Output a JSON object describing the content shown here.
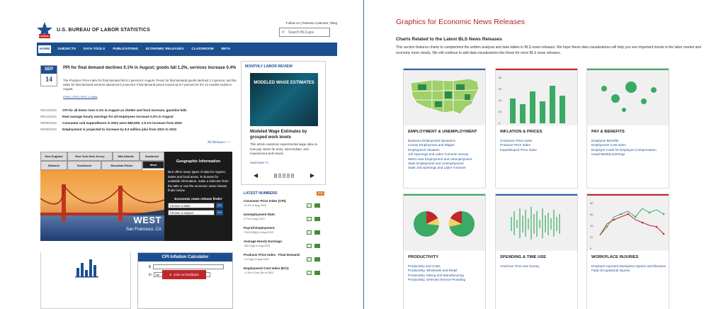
{
  "left": {
    "agency": "U.S. BUREAU OF LABOR STATISTICS",
    "utility": "Follow Us | Release Calendar | Blog",
    "search_placeholder": "Search BLS.gov",
    "nav": [
      "HOME",
      "SUBJECTS",
      "DATA TOOLS",
      "PUBLICATIONS",
      "ECONOMIC RELEASES",
      "CLASSROOM",
      "BETA"
    ],
    "featured": {
      "month": "SEP",
      "day": "14",
      "title": "PPI for final demand declines 0.1% in August; goods fall 1.2%, services increase 0.4%",
      "summary": "The Producer Price Index for final demand fell 0.1 percent in August. Prices for final demand goods declined 1.2 percent, and the index for final demand services advanced 0.4 percent. Final demand prices moved up 8.7 percent for the 12 months ended in August.",
      "links": "HTML | PDF | RSS | Charts"
    },
    "news": [
      {
        "date": "09/13/2022",
        "text": "CPI for all items rises 0.1% in August as shelter and food increase, gasoline falls"
      },
      {
        "date": "09/13/2022",
        "text": "Real average hourly earnings for all employees increase 0.2% in August"
      },
      {
        "date": "09/08/2022",
        "text": "Consumer unit expenditures in 2021 were $66,928; a 9.1% increase from 2020"
      },
      {
        "date": "09/08/2022",
        "text": "Employment is projected to increase by 8.3 million jobs from 2021 to 2031"
      }
    ],
    "all_releases": "All Releases >>",
    "region_tabs_row1": [
      "New England",
      "New York-New Jersey",
      "Mid-Atlantic",
      "Southeast"
    ],
    "region_tabs_row2": [
      "Midwest",
      "Southwest",
      "Mountain-Plains",
      "West"
    ],
    "region_photo_title": "WEST",
    "region_photo_sub": "San Francisco, CA",
    "geo": {
      "title": "Geographic Information",
      "text": "BLS offers many types of data for regions, states and local areas. To browse for available information, make a selection from the tabs or use the economic news release finder below.",
      "finder": "Economic news release finder",
      "state": "Choose a State",
      "subject": "Choose a Subject",
      "go": "GO"
    },
    "mlr": {
      "header": "MONTHLY LABOR REVIEW",
      "image_text": "MODELED WAGE ESTIMATES",
      "title": "Modeled Wage Estimates by grouped work levels",
      "desc": "This article examines experimental wage data on how pay varies for entry, intermediate, and experienced work levels.",
      "read_more": "read more >>",
      "pages": [
        "1",
        "2",
        "3",
        "4",
        "5"
      ]
    },
    "latest": {
      "header": "LATEST NUMBERS",
      "rss": "RSS",
      "items": [
        {
          "label": "Consumer Price Index (CPI):",
          "value": "+0.1% in Aug 2022"
        },
        {
          "label": "Unemployment Rate:",
          "value": "3.7% in Aug 2022"
        },
        {
          "label": "Payroll Employment:",
          "value": "+315,000(p) in Aug 2022"
        },
        {
          "label": "Average Hourly Earnings:",
          "value": "+$0.10(p) in Aug 2022"
        },
        {
          "label": "Producer Price Index - Final Demand:",
          "value": "-0.1%(p) in Aug 2022"
        },
        {
          "label": "Employment Cost Index (ECI):",
          "value": "+1.3% in 2nd Qtr of 2022"
        }
      ]
    },
    "cpi": {
      "title": "CPI Inflation Calculator",
      "dollar": "$",
      "in": "in",
      "month": "Jan"
    },
    "feedback": "Give us feedback"
  },
  "right": {
    "title": "Graphics for Economic News Releases",
    "subtitle": "Charts Related to the Latest BLS News Releases",
    "intro": "This section features charts to complement the written analysis and data tables in BLS news releases. We hope these data visualizations will help you see important trends in the labor market and economy more clearly. We will continue to add data visualizations like these for more BLS news releases.",
    "cards": [
      {
        "title": "EMPLOYMENT & UNEMPLOYMENT",
        "color": "#2f5fa8",
        "links": [
          "Business Employment Dynamics",
          "County Employment and Wages",
          "Employment Situation",
          "Job Openings and Labor Turnover Survey",
          "Metro Area Employment and Unemployment",
          "State Employment and Unemployment",
          "State Job Openings and Labor Turnover"
        ]
      },
      {
        "title": "INFLATION & PRICES",
        "color": "#c0272d",
        "links": [
          "Consumer Price Index",
          "Producer Price Index",
          "Import/Export Price Index"
        ]
      },
      {
        "title": "PAY & BENEFITS",
        "color": "#3aaa64",
        "links": [
          "Employee Benefits",
          "Employment Cost Index",
          "Employer Costs for Employee Compensation",
          "Usual Weekly Earnings"
        ]
      },
      {
        "title": "PRODUCTIVITY",
        "color": "#3aaa64",
        "links": [
          "Productivity and Costs",
          "Productivity, Wholesale and Retail",
          "Productivity, Mining and Manufacturing",
          "Productivity, Selected Service-Providing"
        ]
      },
      {
        "title": "SPENDING & TIME USE",
        "color": "#2f5fa8",
        "links": [
          "American Time Use Survey"
        ]
      },
      {
        "title": "WORKPLACE INJURIES",
        "color": "#c0272d",
        "links": [
          "Employer-reported Workplace Injuries and Illnesses",
          "Fatal Occupational Injuries"
        ]
      }
    ],
    "bar_ticks": [
      "80",
      "60",
      "40",
      "20",
      "0"
    ],
    "line_ticks": [
      "80",
      "60",
      "40",
      "20",
      "0"
    ]
  }
}
